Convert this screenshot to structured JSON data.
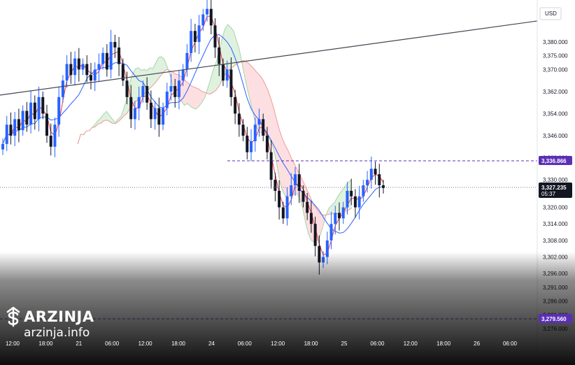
{
  "chart_data": {
    "type": "candlestick",
    "currency": "USD",
    "y_ticks": [
      "3,380.000",
      "3,375.000",
      "3,370.000",
      "3,362.000",
      "3,354.000",
      "3,346.000",
      "3,338.000",
      "3,330.000",
      "3,320.000",
      "3,314.000",
      "3,308.000",
      "3,302.000",
      "3,296.000",
      "3,291.000",
      "3,286.000",
      "3,281.000",
      "3,276.000"
    ],
    "x_ticks": [
      "12:00",
      "18:00",
      "21",
      "06:00",
      "12:00",
      "18:00",
      "24",
      "06:00",
      "12:00",
      "18:00",
      "25",
      "06:00",
      "12:00",
      "18:00",
      "26",
      "06:00"
    ],
    "price_labels": {
      "upper_level": "3,336.866",
      "current": "3,327.235",
      "countdown": "05:37",
      "lower_level": "3,279.560"
    },
    "series": [
      {
        "values": [
          3343,
          3350,
          3346,
          3352,
          3348,
          3355,
          3350,
          3358,
          3352,
          3360,
          3354,
          3346,
          3342,
          3350,
          3360,
          3366,
          3372,
          3368,
          3374,
          3370,
          3372,
          3368,
          3366,
          3370,
          3372,
          3376,
          3370,
          3380,
          3378,
          3372,
          3366,
          3360,
          3352,
          3356,
          3360,
          3364,
          3358,
          3352,
          3356,
          3350,
          3356,
          3362,
          3364,
          3360,
          3366,
          3370,
          3376,
          3384,
          3380,
          3386,
          3390,
          3392,
          3386,
          3378,
          3372,
          3366,
          3370,
          3360,
          3354,
          3350,
          3346,
          3340,
          3344,
          3350,
          3352,
          3346,
          3340,
          3330,
          3326,
          3320,
          3316,
          3324,
          3328,
          3332,
          3326,
          3322,
          3318,
          3314,
          3306,
          3300,
          3302,
          3308,
          3314,
          3318,
          3316,
          3320,
          3326,
          3324,
          3320,
          3324,
          3328,
          3330,
          3334,
          3332,
          3328,
          3327
        ]
      }
    ]
  },
  "watermark": {
    "brand": "ARZINJA",
    "url": "arzinja.info"
  }
}
